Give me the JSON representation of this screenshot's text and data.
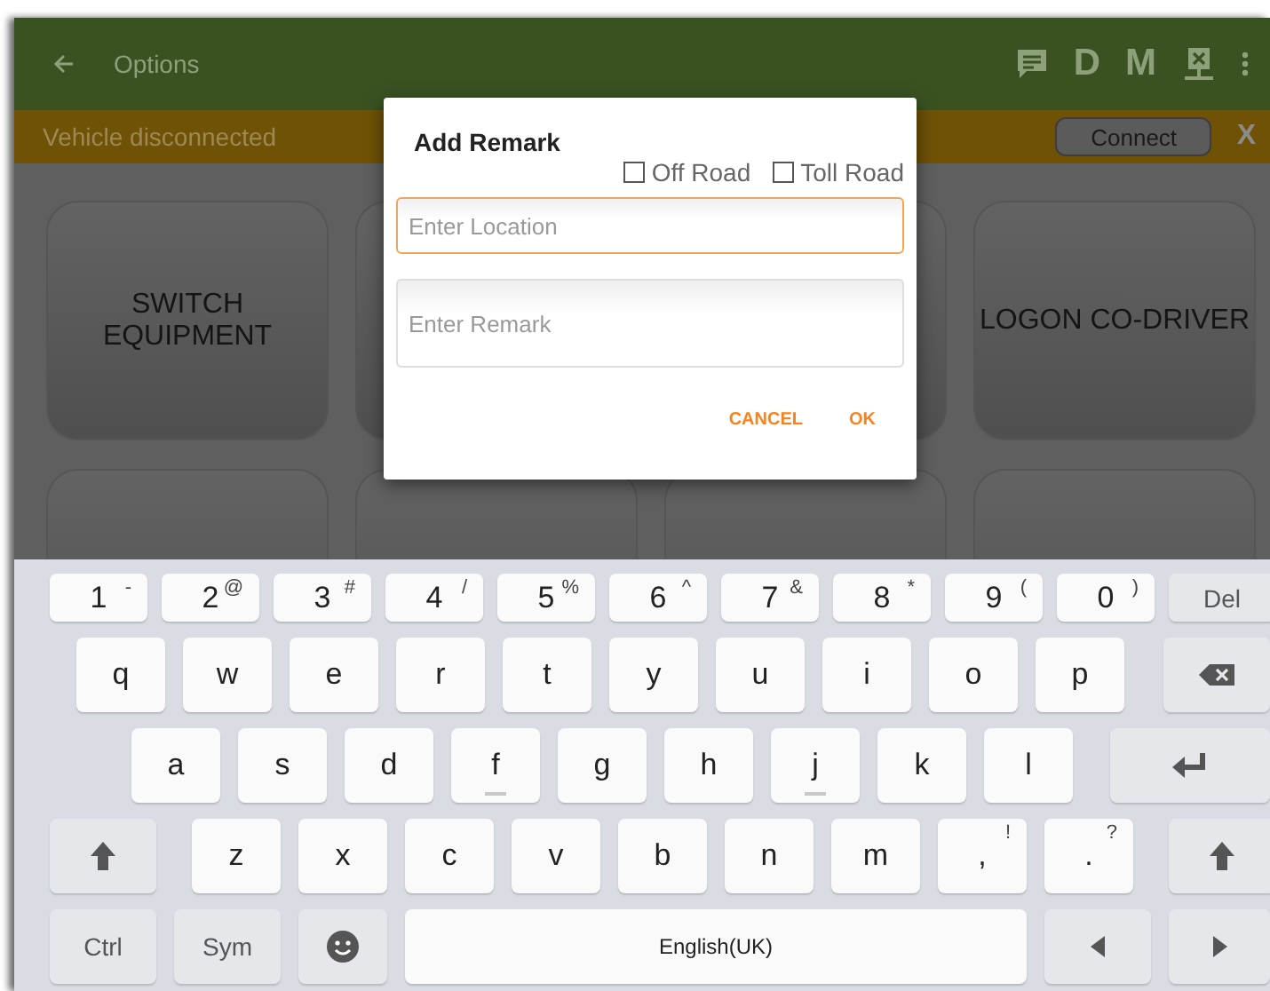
{
  "app_bar": {
    "title": "Options",
    "letters": [
      "D",
      "M"
    ]
  },
  "banner": {
    "text": "Vehicle disconnected",
    "button": "Connect",
    "close": "X"
  },
  "tiles": [
    {
      "kind": "labeled",
      "label": "SWITCH EQUIPMENT"
    },
    {
      "kind": "covered"
    },
    {
      "kind": "covered"
    },
    {
      "kind": "labeled",
      "label": "LOGON CO-DRIVER"
    },
    {
      "kind": "covered"
    },
    {
      "kind": "covered"
    },
    {
      "kind": "covered"
    },
    {
      "kind": "covered"
    }
  ],
  "dialog": {
    "title": "Add Remark",
    "options": [
      {
        "label": "Off Road",
        "checked": false
      },
      {
        "label": "Toll Road",
        "checked": false
      }
    ],
    "fields": [
      {
        "placeholder": "Enter Location",
        "focused": true
      },
      {
        "placeholder": "Enter Remark",
        "focused": false
      }
    ],
    "buttons": [
      "CANCEL",
      "OK"
    ]
  },
  "keyboard": {
    "rows": [
      {
        "keys": [
          {
            "kind": "num",
            "label": "1",
            "alt": "-"
          },
          {
            "kind": "num",
            "label": "2",
            "alt": "@"
          },
          {
            "kind": "num",
            "label": "3",
            "alt": "#"
          },
          {
            "kind": "num",
            "label": "4",
            "alt": "/"
          },
          {
            "kind": "num",
            "label": "5",
            "alt": "%"
          },
          {
            "kind": "num",
            "label": "6",
            "alt": "^"
          },
          {
            "kind": "num",
            "label": "7",
            "alt": "&"
          },
          {
            "kind": "num",
            "label": "8",
            "alt": "*"
          },
          {
            "kind": "num",
            "label": "9",
            "alt": "("
          },
          {
            "kind": "num",
            "label": "0",
            "alt": ")"
          },
          {
            "kind": "del",
            "label": "Del"
          }
        ]
      },
      {
        "keys": [
          {
            "kind": "char",
            "label": "q"
          },
          {
            "kind": "char",
            "label": "w"
          },
          {
            "kind": "char",
            "label": "e"
          },
          {
            "kind": "char",
            "label": "r"
          },
          {
            "kind": "char",
            "label": "t"
          },
          {
            "kind": "char",
            "label": "y"
          },
          {
            "kind": "char",
            "label": "u"
          },
          {
            "kind": "char",
            "label": "i"
          },
          {
            "kind": "char",
            "label": "o"
          },
          {
            "kind": "char",
            "label": "p"
          },
          {
            "kind": "backspace"
          }
        ]
      },
      {
        "keys": [
          {
            "kind": "char",
            "label": "a"
          },
          {
            "kind": "char",
            "label": "s"
          },
          {
            "kind": "char",
            "label": "d"
          },
          {
            "kind": "char",
            "label": "f",
            "homing": true
          },
          {
            "kind": "char",
            "label": "g"
          },
          {
            "kind": "char",
            "label": "h"
          },
          {
            "kind": "char",
            "label": "j",
            "homing": true
          },
          {
            "kind": "char",
            "label": "k"
          },
          {
            "kind": "char",
            "label": "l"
          },
          {
            "kind": "enter"
          }
        ]
      },
      {
        "keys": [
          {
            "kind": "shift"
          },
          {
            "kind": "char",
            "label": "z"
          },
          {
            "kind": "char",
            "label": "x"
          },
          {
            "kind": "char",
            "label": "c"
          },
          {
            "kind": "char",
            "label": "v"
          },
          {
            "kind": "char",
            "label": "b"
          },
          {
            "kind": "char",
            "label": "n"
          },
          {
            "kind": "char",
            "label": "m"
          },
          {
            "kind": "char",
            "label": ",",
            "alt": "!"
          },
          {
            "kind": "char",
            "label": ".",
            "alt": "?"
          },
          {
            "kind": "shift"
          }
        ]
      },
      {
        "keys": [
          {
            "kind": "mod",
            "label": "Ctrl"
          },
          {
            "kind": "mod",
            "label": "Sym"
          },
          {
            "kind": "emoji"
          },
          {
            "kind": "space",
            "label": "English(UK)"
          },
          {
            "kind": "left"
          },
          {
            "kind": "right"
          }
        ]
      }
    ]
  }
}
